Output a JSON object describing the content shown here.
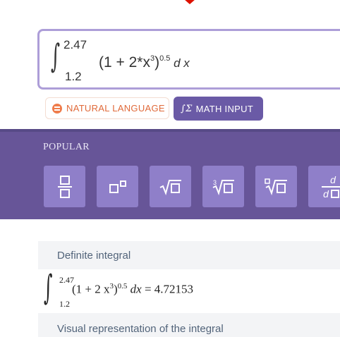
{
  "input": {
    "upper_limit": "2.47",
    "lower_limit": "1.2",
    "integrand_open": "(1 + 2*x",
    "cube_exp": "3",
    "integrand_close": ")",
    "outer_exp": "0.5",
    "differential": "d x"
  },
  "modes": {
    "natural_language": "NATURAL LANGUAGE",
    "math_input": "MATH INPUT"
  },
  "palette": {
    "label": "POPULAR",
    "buttons": [
      "fraction",
      "superscript",
      "square-root",
      "cube-root",
      "nth-root",
      "derivative"
    ],
    "deriv_top": "d",
    "deriv_bottom": "d",
    "cube_index": "3"
  },
  "result": {
    "heading": "Definite integral",
    "upper": "2.47",
    "lower": "1.2",
    "expr_start": "(1 + 2 x",
    "expr_exp3": "3",
    "expr_close": ")",
    "expr_exp": "0.5",
    "dx": "dx",
    "equals": "= 4.72153",
    "next_heading": "Visual representation of the integral"
  },
  "colors": {
    "accent": "#675598",
    "button": "#8f7fc9",
    "orange": "#e06a3a",
    "logo_red": "#dd1100"
  }
}
